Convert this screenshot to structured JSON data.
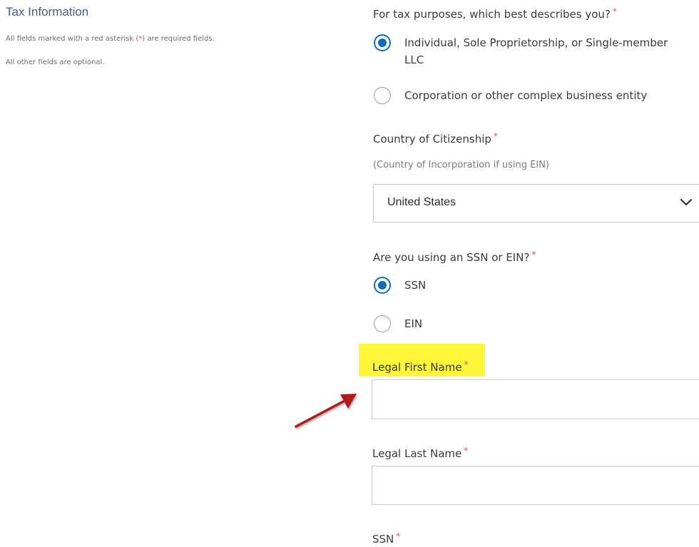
{
  "left_panel": {
    "title": "Tax Information",
    "help_line1_pre": "All fields marked with a red asterisk (",
    "help_line1_star": "*",
    "help_line1_post": ") are required fields.",
    "help_line2": "All other fields are optional."
  },
  "tax_type": {
    "question": "For tax purposes, which best describes you?",
    "asterisk": "*",
    "options": [
      {
        "label_line1": "Individual, Sole Proprietorship, or Single-member",
        "label_line2": "LLC",
        "selected": true
      },
      {
        "label_line1": "Corporation or other complex business entity",
        "selected": false
      }
    ]
  },
  "citizenship": {
    "label": "Country of Citizenship",
    "asterisk": "*",
    "help": "(Country of Incorporation if using EIN)",
    "selected_value": "United States"
  },
  "id_type": {
    "question": "Are you using an SSN or EIN?",
    "asterisk": "*",
    "options": [
      {
        "label": "SSN",
        "selected": true
      },
      {
        "label": "EIN",
        "selected": false
      }
    ]
  },
  "first_name": {
    "label": "Legal First Name",
    "asterisk": "*",
    "value": ""
  },
  "last_name": {
    "label": "Legal Last Name",
    "asterisk": "*",
    "value": ""
  },
  "ssn": {
    "label": "SSN",
    "asterisk": "*"
  },
  "colors": {
    "accent": "#0f6cbd",
    "required": "#d9534f",
    "highlight": "#fff73a",
    "arrow": "#b01d1d"
  }
}
